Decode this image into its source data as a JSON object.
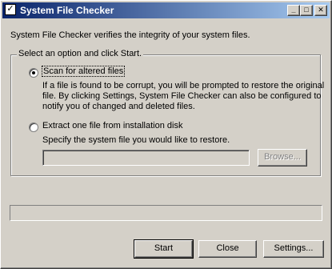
{
  "window": {
    "title": "System File Checker",
    "minimize_glyph": "_",
    "maximize_glyph": "□",
    "close_glyph": "✕",
    "titlebar_color": "#0a246a"
  },
  "intro": "System File Checker verifies the integrity of your system files.",
  "group": {
    "legend": "Select an option and click Start.",
    "option1": {
      "label": "Scan for altered files",
      "selected": true,
      "description_lines": [
        "If a file is found to be corrupt, you will be prompted to restore the original",
        "file. By clicking Settings, System File Checker can also be configured to",
        "notify you of changed and deleted files."
      ]
    },
    "option2": {
      "label": "Extract one file from installation disk",
      "selected": false,
      "description": "Specify the system file you would like to restore.",
      "path_value": "",
      "browse_label": "Browse..."
    }
  },
  "progress": {
    "value": 0
  },
  "buttons": {
    "start": "Start",
    "close": "Close",
    "settings": "Settings..."
  }
}
